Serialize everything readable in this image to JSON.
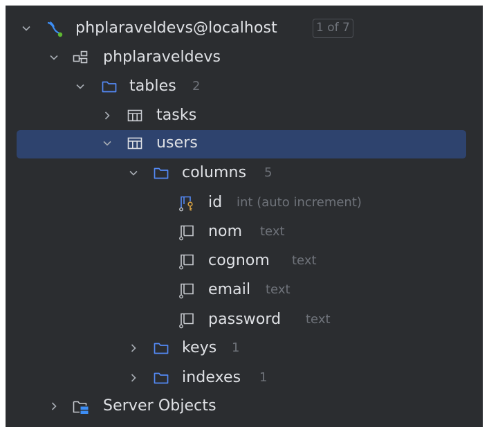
{
  "colors": {
    "background": "#2b2d30",
    "selection": "#2e436e",
    "text": "#dfe1e5",
    "muted": "#6f737a",
    "folder": "#548af7",
    "key": "#d9a343",
    "datasource": "#3d8ef5"
  },
  "tree": {
    "datasource": {
      "label": "phplaraveldevs@localhost",
      "badge": "1 of 7",
      "icon": "mysql-datasource-icon"
    },
    "schema": {
      "label": "phplaraveldevs",
      "icon": "schema-icon"
    },
    "tables_folder": {
      "label": "tables",
      "count": "2",
      "icon": "folder-icon"
    },
    "table_tasks": {
      "label": "tasks",
      "icon": "table-icon"
    },
    "table_users": {
      "label": "users",
      "icon": "table-icon"
    },
    "columns_folder": {
      "label": "columns",
      "count": "5",
      "icon": "folder-icon"
    },
    "columns": [
      {
        "name": "id",
        "type": "int (auto increment)",
        "icon": "primary-key-column-icon"
      },
      {
        "name": "nom",
        "type": "text",
        "icon": "column-icon"
      },
      {
        "name": "cognom",
        "type": "text",
        "icon": "column-icon"
      },
      {
        "name": "email",
        "type": "text",
        "icon": "column-icon"
      },
      {
        "name": "password",
        "type": "text",
        "icon": "column-icon"
      }
    ],
    "keys_folder": {
      "label": "keys",
      "count": "1",
      "icon": "folder-icon"
    },
    "indexes_folder": {
      "label": "indexes",
      "count": "1",
      "icon": "folder-icon"
    },
    "server_objects": {
      "label": "Server Objects",
      "icon": "server-objects-icon"
    }
  }
}
